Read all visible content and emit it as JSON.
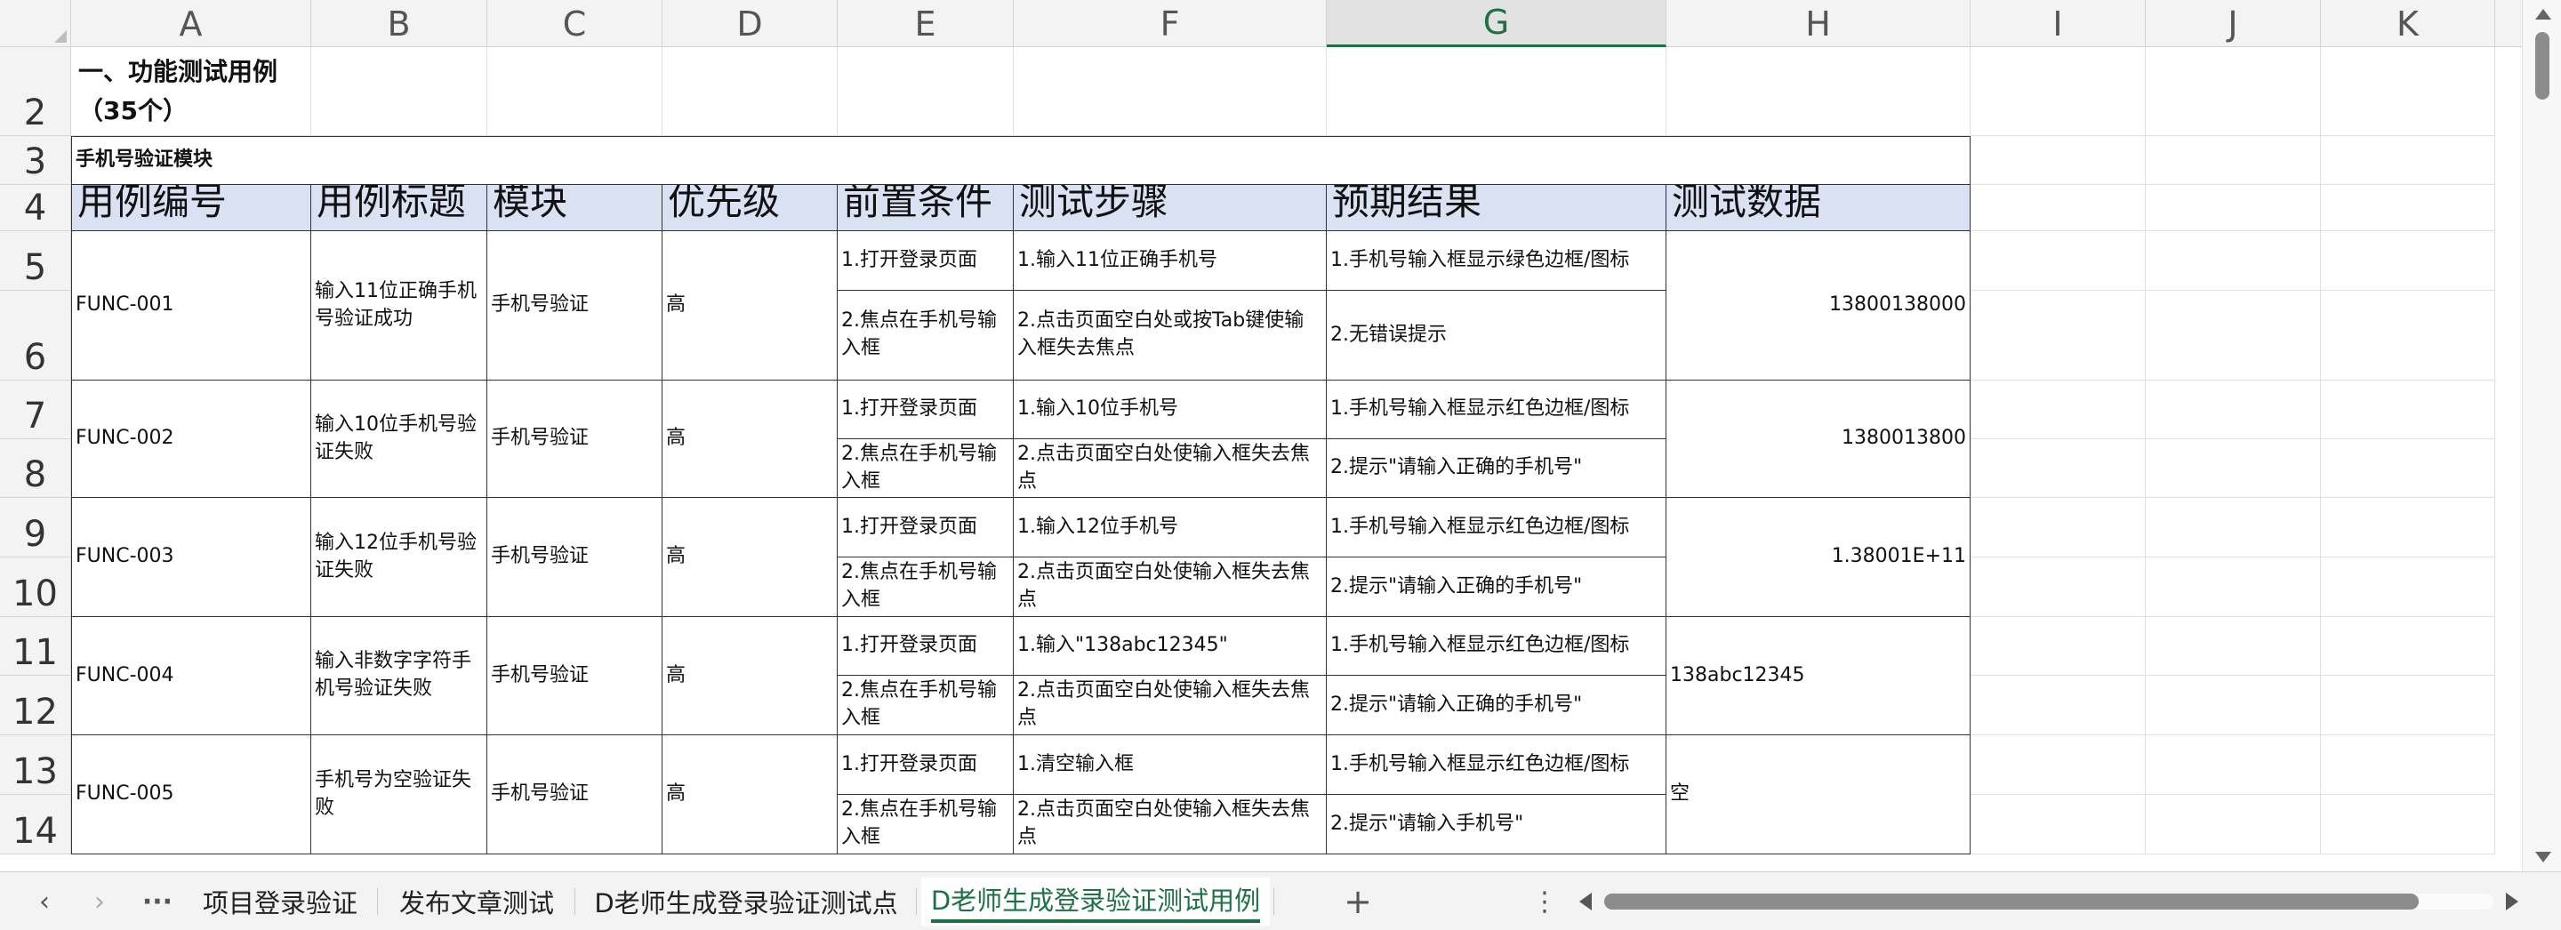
{
  "columns": [
    "A",
    "B",
    "C",
    "D",
    "E",
    "F",
    "G",
    "H",
    "I",
    "J",
    "K"
  ],
  "selected_column": "G",
  "row_numbers": [
    "2",
    "3",
    "4",
    "5",
    "6",
    "7",
    "8",
    "9",
    "10",
    "11",
    "12",
    "13",
    "14"
  ],
  "title": "一、功能测试用例（35个）",
  "section": "手机号验证模块",
  "headers": [
    "用例编号",
    "用例标题",
    "模块",
    "优先级",
    "前置条件",
    "测试步骤",
    "预期结果",
    "测试数据"
  ],
  "cases": [
    {
      "id": "FUNC-001",
      "title": "输入11位正确手机号验证成功",
      "module": "手机号验证",
      "priority": "高",
      "pre1": "1.打开登录页面",
      "pre2": "2.焦点在手机号输入框",
      "step1": "1.输入11位正确手机号",
      "step2": "2.点击页面空白处或按Tab键使输入框失去焦点",
      "exp1": "1.手机号输入框显示绿色边框/图标",
      "exp2": "2.无错误提示",
      "data": "13800138000"
    },
    {
      "id": "FUNC-002",
      "title": "输入10位手机号验证失败",
      "module": "手机号验证",
      "priority": "高",
      "pre1": "1.打开登录页面",
      "pre2": "2.焦点在手机号输入框",
      "step1": "1.输入10位手机号",
      "step2": "2.点击页面空白处使输入框失去焦点",
      "exp1": "1.手机号输入框显示红色边框/图标",
      "exp2": "2.提示\"请输入正确的手机号\"",
      "data": "1380013800"
    },
    {
      "id": "FUNC-003",
      "title": "输入12位手机号验证失败",
      "module": "手机号验证",
      "priority": "高",
      "pre1": "1.打开登录页面",
      "pre2": "2.焦点在手机号输入框",
      "step1": "1.输入12位手机号",
      "step2": "2.点击页面空白处使输入框失去焦点",
      "exp1": "1.手机号输入框显示红色边框/图标",
      "exp2": "2.提示\"请输入正确的手机号\"",
      "data": "1.38001E+11"
    },
    {
      "id": "FUNC-004",
      "title": "输入非数字字符手机号验证失败",
      "module": "手机号验证",
      "priority": "高",
      "pre1": "1.打开登录页面",
      "pre2": "2.焦点在手机号输入框",
      "step1": "1.输入\"138abc12345\"",
      "step2": "2.点击页面空白处使输入框失去焦点",
      "exp1": "1.手机号输入框显示红色边框/图标",
      "exp2": "2.提示\"请输入正确的手机号\"",
      "data": "138abc12345"
    },
    {
      "id": "FUNC-005",
      "title": "手机号为空验证失败",
      "module": "手机号验证",
      "priority": "高",
      "pre1": "1.打开登录页面",
      "pre2": "2.焦点在手机号输入框",
      "step1": "1.清空输入框",
      "step2": "2.点击页面空白处使输入框失去焦点",
      "exp1": "1.手机号输入框显示红色边框/图标",
      "exp2": "2.提示\"请输入手机号\"",
      "data": "空"
    }
  ],
  "tabs": [
    "项目登录验证",
    "发布文章测试",
    "D老师生成登录验证测试点",
    "D老师生成登录验证测试用例"
  ],
  "active_tab": "D老师生成登录验证测试用例",
  "tabbar_icons": [
    "chevron-left-icon",
    "chevron-right-icon",
    "more-icon",
    "add-sheet-icon",
    "vertical-more-icon"
  ],
  "glyphs": {
    "prev": "‹",
    "next": "›",
    "more": "···",
    "add": "+",
    "vmore": "⋮"
  },
  "colors": {
    "accent": "#1e7145",
    "header_fill": "#d9e1f2"
  }
}
